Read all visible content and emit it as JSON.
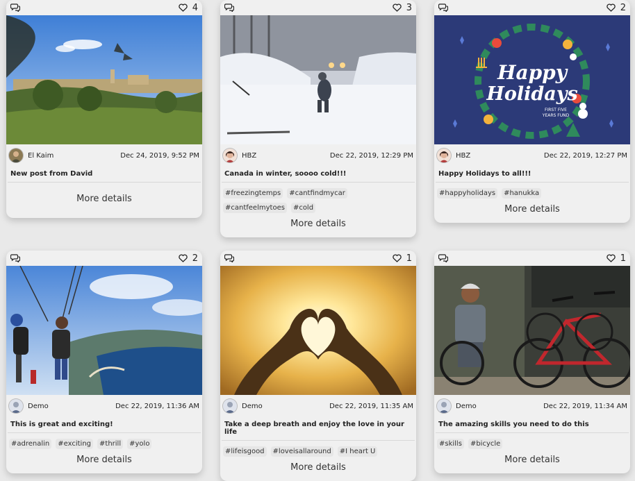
{
  "cards": [
    {
      "likes": "4",
      "author": "El Kaim",
      "date": "Dec 24, 2019, 9:52 PM",
      "caption": "New post from David",
      "tags": [],
      "more": "More details",
      "photo": "landscape-hill-photo"
    },
    {
      "likes": "3",
      "author": "HBZ",
      "date": "Dec 22, 2019, 12:29 PM",
      "caption": "Canada in winter, soooo cold!!!",
      "tags": [
        "#freezingtemps",
        "#cantfindmycar",
        "#cantfeelmytoes",
        "#cold"
      ],
      "more": "More details",
      "photo": "snowy-street-photo"
    },
    {
      "likes": "2",
      "author": "HBZ",
      "date": "Dec 22, 2019, 12:27 PM",
      "caption": "Happy Holidays to all!!!",
      "tags": [
        "#happyholidays",
        "#hanukka"
      ],
      "more": "More details",
      "photo": "happy-holidays-illustration",
      "image_text": {
        "line1": "Happy",
        "line2": "Holidays",
        "line3": "FIRST FIVE",
        "line4": "YEARS FUND"
      }
    },
    {
      "likes": "2",
      "author": "Demo",
      "date": "Dec 22, 2019, 11:36 AM",
      "caption": "This is great and exciting!",
      "tags": [
        "#adrenalin",
        "#exciting",
        "#thrill",
        "#yolo"
      ],
      "more": "More details",
      "photo": "paragliding-photo"
    },
    {
      "likes": "1",
      "author": "Demo",
      "date": "Dec 22, 2019, 11:35 AM",
      "caption": "Take a deep breath and enjoy the love in your life",
      "tags": [
        "#lifeisgood",
        "#loveisallaround",
        "#I heart U"
      ],
      "more": "More details",
      "photo": "heart-hands-sunset-photo"
    },
    {
      "likes": "1",
      "author": "Demo",
      "date": "Dec 22, 2019, 11:34 AM",
      "caption": "The amazing skills you need to do this",
      "tags": [
        "#skills",
        "#bicycle"
      ],
      "more": "More details",
      "photo": "bicycle-repair-photo"
    }
  ],
  "colors": {
    "card_bg": "#f0f0f0",
    "page_bg": "#e9e9e9",
    "tag_bg": "#e6e6e6",
    "holiday_bg": "#2c3a78"
  }
}
